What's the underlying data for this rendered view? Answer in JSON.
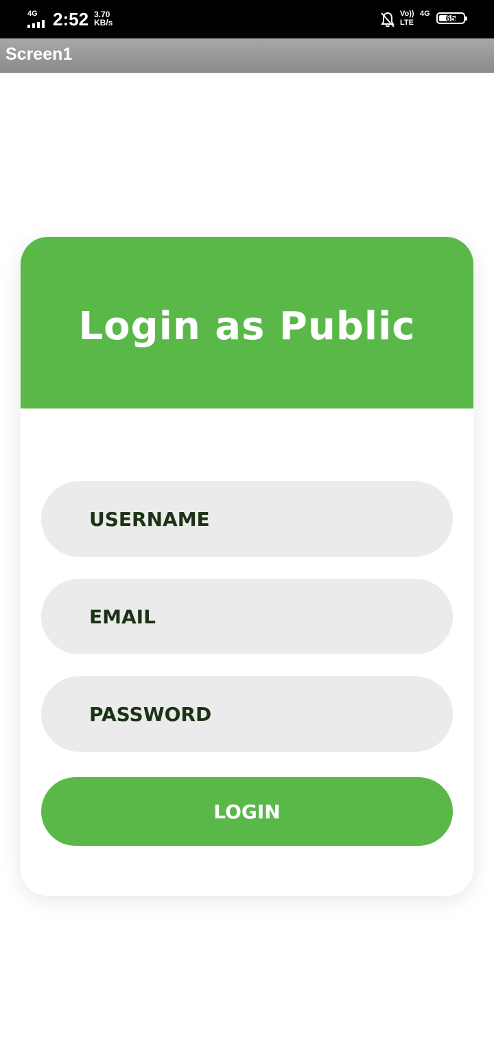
{
  "status_bar": {
    "network_type": "4G",
    "time": "2:52",
    "net_speed_value": "3.70",
    "net_speed_unit": "KB/s",
    "volte_line1": "Vo))",
    "volte_line2": "LTE",
    "data_type": "4G",
    "battery_level": "65"
  },
  "titlebar": {
    "title": "Screen1"
  },
  "login_card": {
    "heading": "Login as Public",
    "username_placeholder": "USERNAME",
    "email_placeholder": "EMAIL",
    "password_placeholder": "PASSWORD",
    "login_label": "LOGIN",
    "accent_color": "#5ab849",
    "field_background": "#ebebeb"
  }
}
